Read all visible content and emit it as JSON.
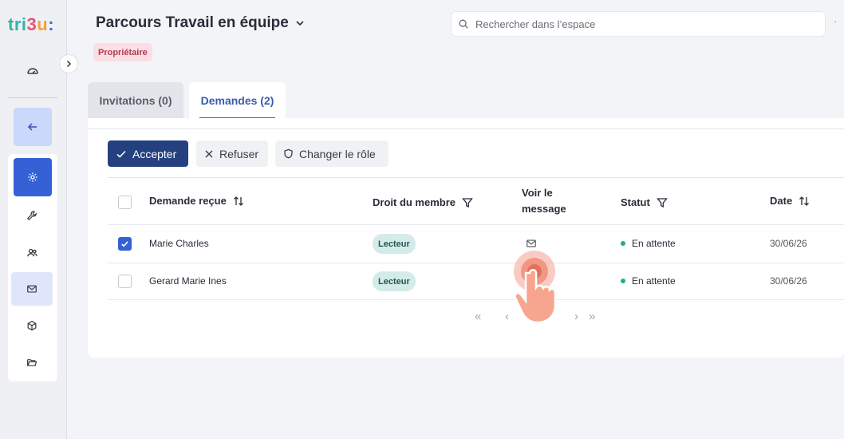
{
  "app": {
    "logo": {
      "part1": "tri",
      "part2": "3",
      "part3": "u",
      "part4": ":"
    }
  },
  "header": {
    "title": "Parcours Travail en équipe",
    "role_badge": "Propriétaire",
    "search_placeholder": "Rechercher dans l’espace"
  },
  "sidebar": {
    "items": [
      {
        "icon": "dashboard-icon"
      },
      {
        "icon": "arrow-left-icon"
      },
      {
        "icon": "gear-icon",
        "state": "active"
      },
      {
        "icon": "wrench-icon"
      },
      {
        "icon": "users-icon"
      },
      {
        "icon": "mail-icon",
        "state": "selected"
      },
      {
        "icon": "cube-icon"
      },
      {
        "icon": "folder-icon"
      }
    ]
  },
  "tabs": [
    {
      "label": "Invitations (0)",
      "active": false
    },
    {
      "label": "Demandes (2)",
      "active": true
    }
  ],
  "toolbar": {
    "accept_label": "Accepter",
    "refuse_label": "Refuser",
    "change_role_label": "Changer le rôle"
  },
  "table": {
    "headers": {
      "request": "Demande reçue",
      "role": "Droit du membre",
      "message_line1": "Voir le",
      "message_line2": "message",
      "status": "Statut",
      "date": "Date"
    },
    "rows": [
      {
        "name": "Marie Charles",
        "role": "Lecteur",
        "status": "En attente",
        "date": "30/06/26",
        "checked": true
      },
      {
        "name": "Gerard Marie Ines",
        "role": "Lecteur",
        "status": "En attente",
        "date": "30/06/26",
        "checked": false
      }
    ]
  },
  "pagination": {
    "first": "«",
    "prev": "‹",
    "next": "›",
    "last": "»"
  },
  "colors": {
    "primary": "#3561d6",
    "accept_button": "#24407e",
    "status_pending": "#21b36e",
    "role_pill": "#d4ece9",
    "owner_badge": "#fbdfe4"
  }
}
